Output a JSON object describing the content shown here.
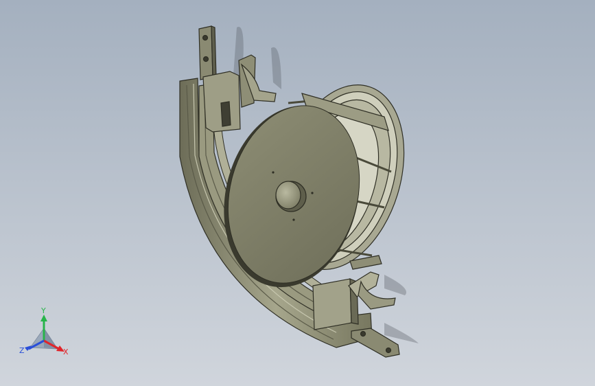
{
  "viewport": {
    "background_top": "#a4b0bf",
    "background_bottom": "#d0d5dc",
    "model_color": "#8a8a72",
    "model_edge_color": "#2e2e24"
  },
  "triad": {
    "x_label": "X",
    "y_label": "Y",
    "z_label": "Z",
    "x_color": "#e0252b",
    "y_color": "#27b44a",
    "z_color": "#2a4fd8"
  },
  "model": {
    "parts": [
      "mounting-bracket-top",
      "curved-rail",
      "reel-disc",
      "reel-cage",
      "hub",
      "mounting-bracket-bottom"
    ]
  }
}
